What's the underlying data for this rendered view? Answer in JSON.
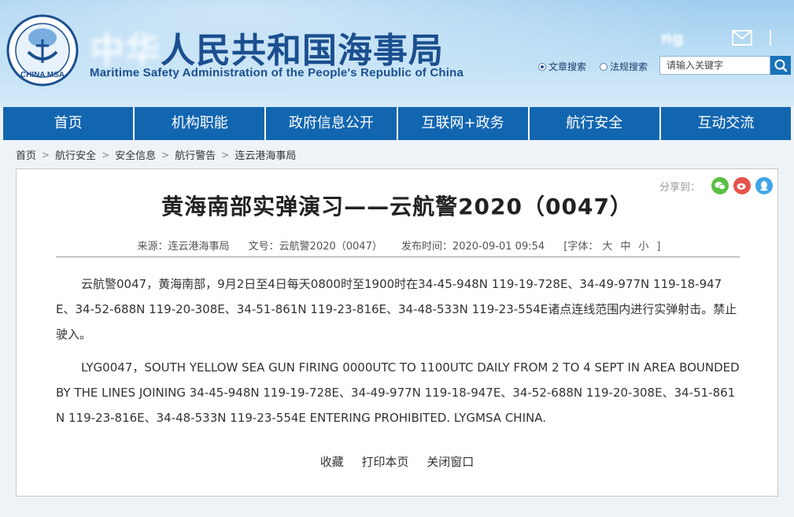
{
  "header": {
    "title_cn_visible": "人民共和国海事局",
    "title_cn_blurred": "中华",
    "title_en": "Maritime Safety Administration of the People's Republic of China",
    "logo_text": "CHINA MSA",
    "search": {
      "option_article": "文章搜索",
      "option_regulation": "法规搜索",
      "placeholder": "请输入关键字"
    }
  },
  "nav": {
    "items": [
      "首页",
      "机构职能",
      "政府信息公开",
      "互联网+政务",
      "航行安全",
      "互动交流"
    ]
  },
  "breadcrumb": [
    "首页",
    "航行安全",
    "安全信息",
    "航行警告",
    "连云港海事局"
  ],
  "article": {
    "share_label": "分享到：",
    "title": "黄海南部实弹演习——云航警2020（0047）",
    "meta": {
      "source": "来源：连云港海事局",
      "doc_no": "文号：云航警2020（0047）",
      "published": "发布时间：2020-09-01 09:54",
      "font_label": "[字体：",
      "font_large": "大",
      "font_medium": "中",
      "font_small": "小",
      "font_close": "]"
    },
    "para_cn": "云航警0047，黄海南部，9月2日至4日每天0800时至1900时在34-45-948N 119-19-728E、34-49-977N 119-18-947E、34-52-688N 119-20-308E、34-51-861N 119-23-816E、34-48-533N 119-23-554E诸点连线范围内进行实弹射击。禁止驶入。",
    "para_en": "LYG0047，SOUTH YELLOW SEA GUN FIRING 0000UTC TO 1100UTC DAILY FROM 2 TO 4 SEPT IN AREA BOUNDED BY THE LINES JOINING 34-45-948N 119-19-728E、34-49-977N 119-18-947E、34-52-688N 119-20-308E、34-51-861N 119-23-816E、34-48-533N 119-23-554E ENTERING PROHIBITED. LYGMSA CHINA.",
    "actions": {
      "favorite": "收藏",
      "print": "打印本页",
      "close": "关闭窗口"
    }
  },
  "colors": {
    "nav_bg": "#1266b0",
    "brand_blue": "#1b4f8f",
    "wechat": "#5bbf44",
    "weibo": "#e5534b",
    "qq": "#3ea6e8"
  }
}
